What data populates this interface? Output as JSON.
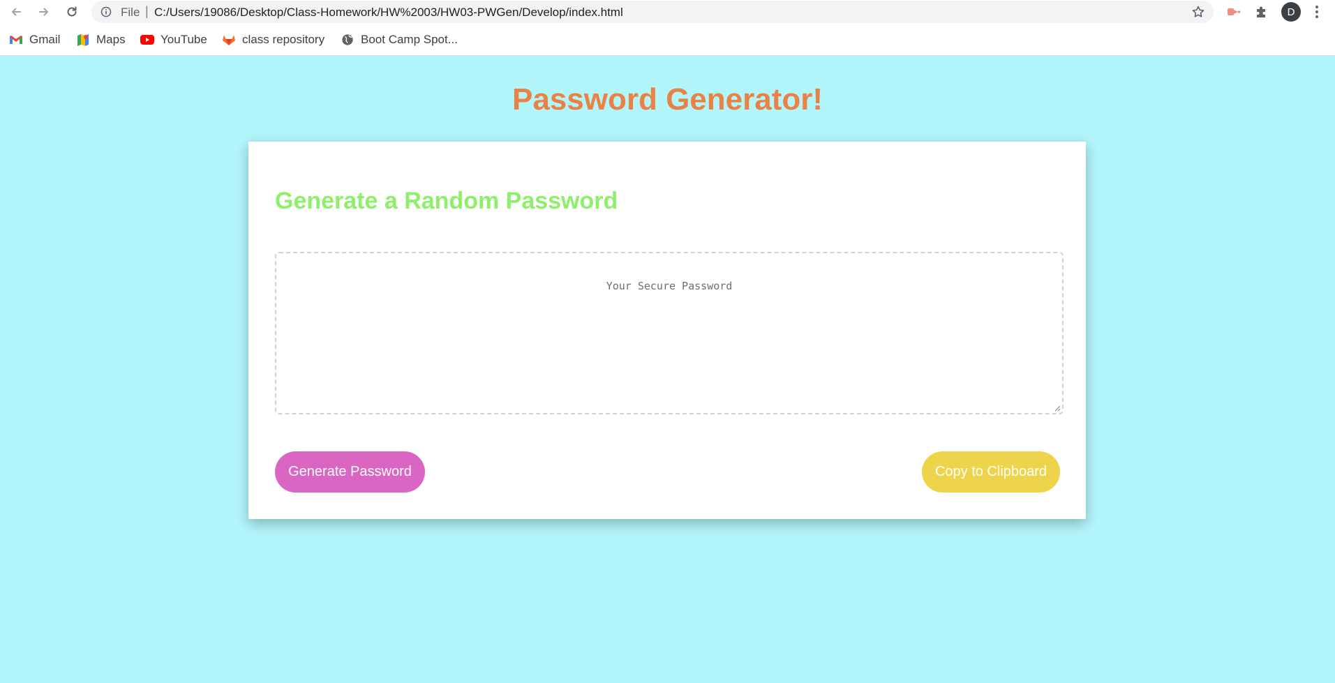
{
  "browser": {
    "omnibox": {
      "scheme": "File",
      "separator": "|",
      "url": "C:/Users/19086/Desktop/Class-Homework/HW%2003/HW03-PWGen/Develop/index.html"
    },
    "profile_initial": "D",
    "bookmarks": [
      {
        "label": "Gmail",
        "icon": "gmail-icon"
      },
      {
        "label": "Maps",
        "icon": "maps-icon"
      },
      {
        "label": "YouTube",
        "icon": "youtube-icon"
      },
      {
        "label": "class repository",
        "icon": "gitlab-icon"
      },
      {
        "label": "Boot Camp Spot...",
        "icon": "globe-icon"
      }
    ]
  },
  "page": {
    "title": "Password Generator!",
    "card": {
      "heading": "Generate a Random Password",
      "password_placeholder": "Your Secure Password",
      "generate_label": "Generate Password",
      "copy_label": "Copy to Clipboard"
    },
    "colors": {
      "background": "#b2f5fb",
      "title": "#e98244",
      "heading": "#8ef06a",
      "generate_button": "#db65c3",
      "copy_button": "#eed44a"
    }
  }
}
